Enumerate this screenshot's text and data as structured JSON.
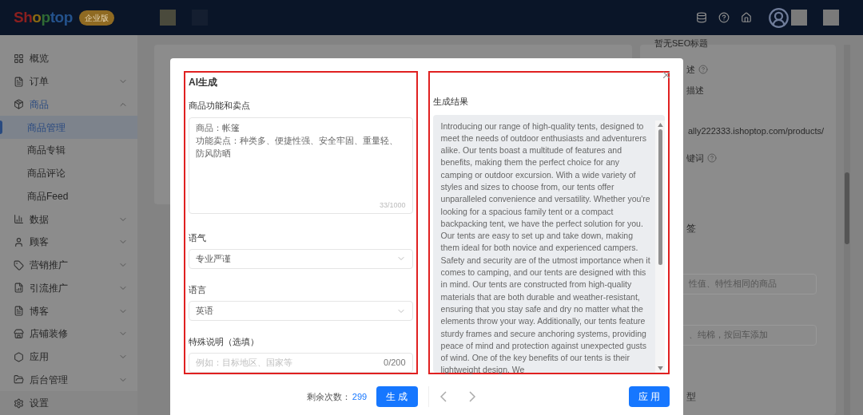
{
  "header": {
    "logo": "Shoptop",
    "badge": "企业版"
  },
  "sidebar": {
    "items": [
      {
        "label": "概览",
        "selected": false
      },
      {
        "label": "订单",
        "selected": false,
        "expanded": false
      },
      {
        "label": "商品",
        "selected": true,
        "expanded": true,
        "children": [
          {
            "label": "商品管理",
            "selected": true
          },
          {
            "label": "商品专辑",
            "selected": false
          },
          {
            "label": "商品评论",
            "selected": false
          },
          {
            "label": "商品Feed",
            "selected": false
          }
        ]
      },
      {
        "label": "数据",
        "selected": false,
        "expanded": false
      },
      {
        "label": "顾客",
        "selected": false,
        "expanded": false
      },
      {
        "label": "营销推广",
        "selected": false,
        "expanded": false
      },
      {
        "label": "引流推广",
        "selected": false,
        "expanded": false
      },
      {
        "label": "博客",
        "selected": false,
        "expanded": false
      },
      {
        "label": "店铺装修",
        "selected": false,
        "expanded": false
      },
      {
        "label": "应用",
        "selected": false,
        "expanded": false
      },
      {
        "label": "后台管理",
        "selected": false,
        "expanded": false
      }
    ],
    "footer_item": {
      "label": "设置"
    }
  },
  "background_panel": {
    "seo_title": "暂无SEO标题",
    "description_label": "述",
    "description_value": "描述",
    "url": "ally222333.ishoptop.com/products/",
    "keywords_label": "键词",
    "tags_label": "签",
    "tags_placeholder_1": "性值、特性相同的商品",
    "tags_placeholder_2": "、纯棉，按回车添加",
    "type_label": "型"
  },
  "modal": {
    "left": {
      "title": "AI生成",
      "features_label": "商品功能和卖点",
      "features_lines": [
        "商品：帐篷",
        "功能卖点：种类多、便捷性强、安全牢固、重量轻、防风防晒"
      ],
      "features_count": "33/1000",
      "tone_label": "语气",
      "tone_value": "专业严谨",
      "language_label": "语言",
      "language_value": "英语",
      "notes_label": "特殊说明（选填）",
      "notes_placeholder": "例如：目标地区、国家等",
      "notes_count": "0/200"
    },
    "remaining_label": "剩余次数：",
    "remaining_value": "299",
    "generate_button": "生 成",
    "right": {
      "title": "生成结果",
      "result_text": "Introducing our range of high-quality tents, designed to meet the needs of outdoor enthusiasts and adventurers alike. Our tents boast a multitude of features and benefits, making them the perfect choice for any camping or outdoor excursion. With a wide variety of styles and sizes to choose from, our tents offer unparalleled convenience and versatility. Whether you're looking for a spacious family tent or a compact backpacking tent, we have the perfect solution for you. Our tents are easy to set up and take down, making them ideal for both novice and experienced campers. Safety and security are of the utmost importance when it comes to camping, and our tents are designed with this in mind. Our tents are constructed from high-quality materials that are both durable and weather-resistant, ensuring that you stay safe and dry no matter what the elements throw your way. Additionally, our tents feature sturdy frames and secure anchoring systems, providing peace of mind and protection against unexpected gusts of wind. One of the key benefits of our tents is their lightweight design. We"
    },
    "apply_button": "应 用"
  }
}
